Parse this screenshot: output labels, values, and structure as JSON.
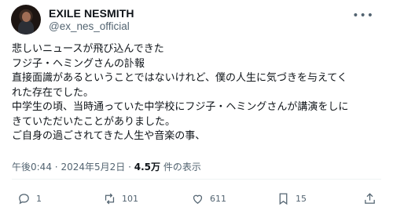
{
  "author": {
    "name": "EXILE NESMITH",
    "handle": "@ex_nes_official"
  },
  "post": {
    "lines": [
      "悲しいニュースが飛び込んできた",
      "フジ子・ヘミングさんの訃報",
      "直接面識があるということではないけれど、僕の人生に気づきを与えてく",
      "れた存在でした。",
      "中学生の頃、当時通っていた中学校にフジ子・ヘミングさんが講演をしに",
      "きていただいたことがありました。",
      "ご自身の過ごされてきた人生や音楽の事、"
    ],
    "time": "午後0:44",
    "date": "2024年5月2日",
    "views": "4.5万",
    "views_label": "件の表示",
    "separator": "·"
  },
  "actions": {
    "reply": {
      "icon": "reply-icon",
      "count": "1"
    },
    "repost": {
      "icon": "repost-icon",
      "count": "101"
    },
    "like": {
      "icon": "like-icon",
      "count": "611"
    },
    "bookmark": {
      "icon": "bookmark-icon",
      "count": "15"
    },
    "share": {
      "icon": "share-icon"
    }
  },
  "more_icon": "more-options-icon"
}
